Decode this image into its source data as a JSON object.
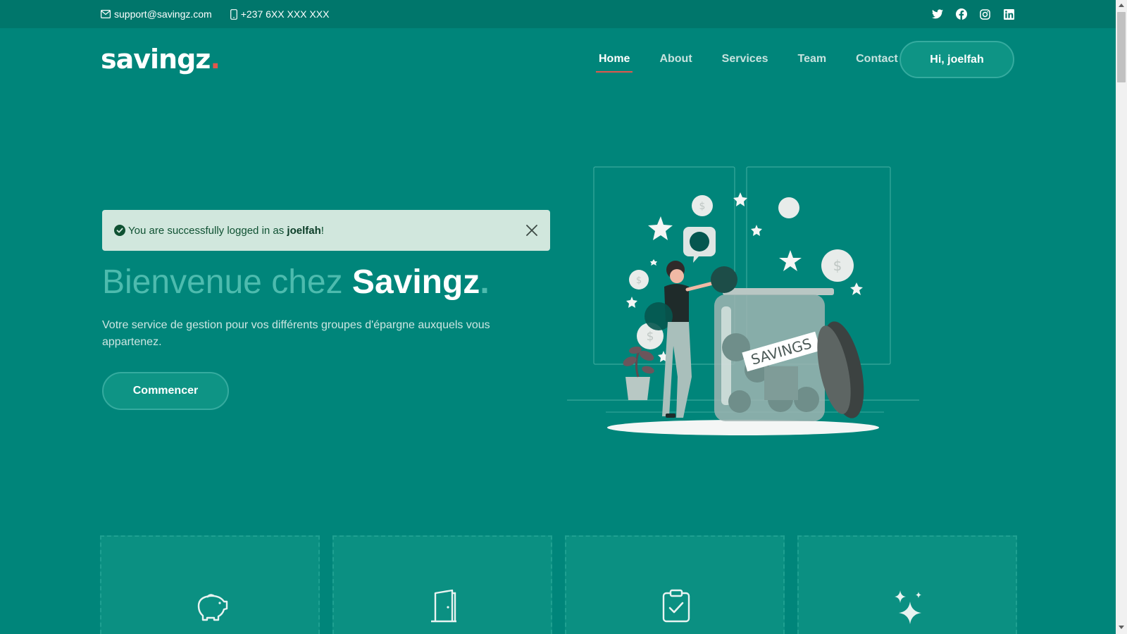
{
  "topbar": {
    "email": "support@savingz.com",
    "phone": "+237 6XX XXX XXX",
    "social": [
      "twitter-icon",
      "facebook-icon",
      "instagram-icon",
      "linkedin-icon"
    ]
  },
  "header": {
    "logo_text": "savingz",
    "logo_dot": ".",
    "nav": [
      {
        "label": "Home",
        "active": true
      },
      {
        "label": "About",
        "active": false
      },
      {
        "label": "Services",
        "active": false
      },
      {
        "label": "Team",
        "active": false
      },
      {
        "label": "Contact",
        "active": false
      }
    ],
    "user_button": "Hi, joelfah"
  },
  "alert": {
    "prefix": "You are successfully logged in as ",
    "username": "joelfah",
    "suffix": "!"
  },
  "hero": {
    "title_light": "Bienvenue chez ",
    "title_strong": "Savingz",
    "title_dot": ".",
    "description": "Votre service de gestion pour vos différents groupes d'épargne auxquels vous appartenez.",
    "cta_label": "Commencer",
    "illustration_label": "SAVINGS"
  },
  "feature_cards": [
    {
      "icon": "piggy-bank-icon"
    },
    {
      "icon": "door-icon"
    },
    {
      "icon": "clipboard-check-icon"
    },
    {
      "icon": "sparkles-icon"
    }
  ],
  "colors": {
    "background": "#00857a",
    "topbar": "#00766b",
    "accent": "#e2574c",
    "alert_bg": "#d1e7dd",
    "alert_text": "#0f5132"
  }
}
